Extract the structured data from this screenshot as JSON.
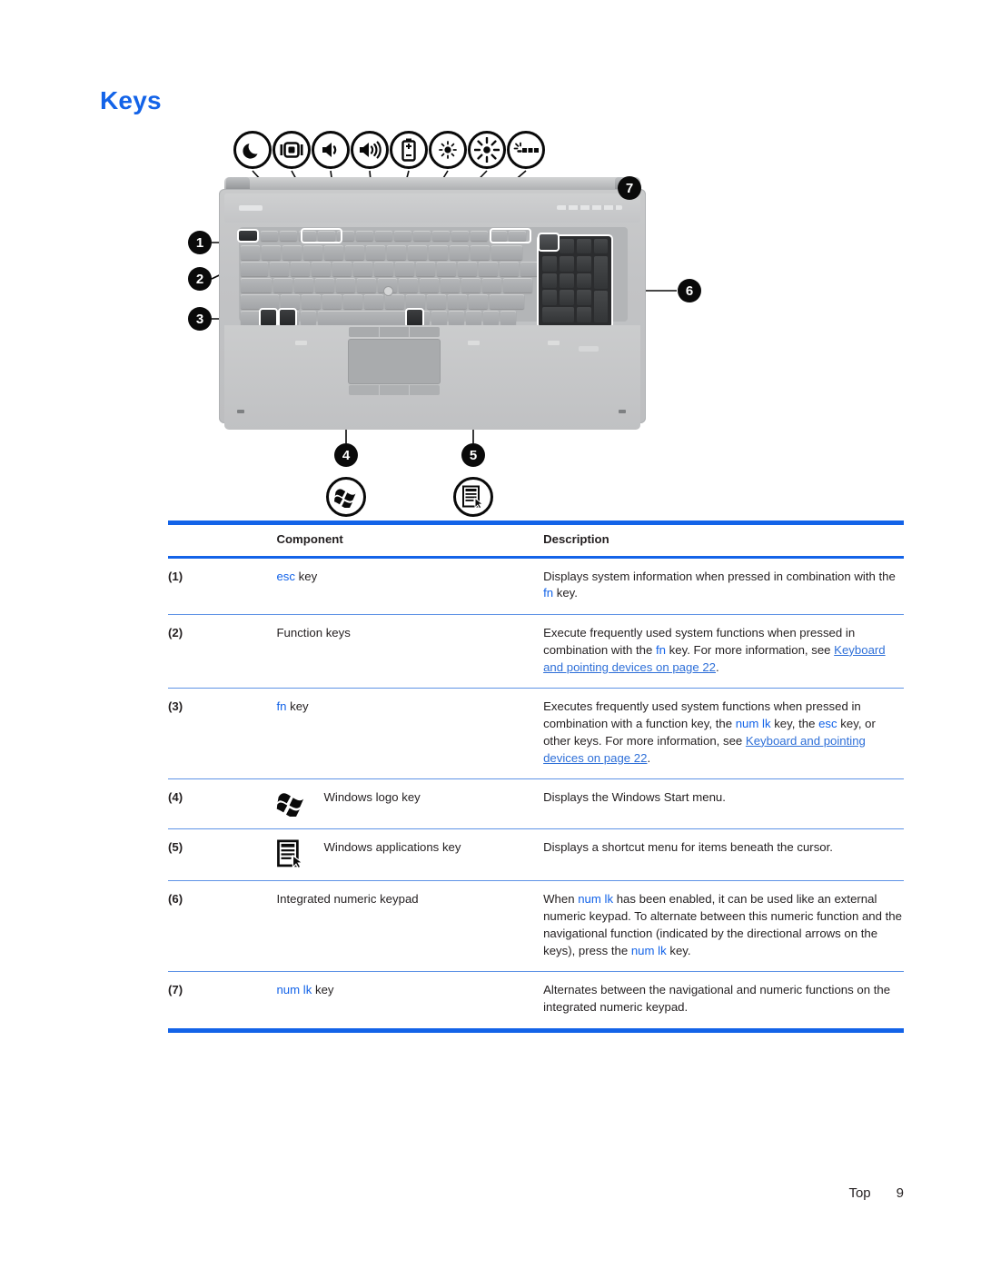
{
  "page": {
    "title": "Keys",
    "footer_label": "Top",
    "page_number": "9"
  },
  "colors": {
    "heading_blue": "#1363e8",
    "link_blue": "#2e6fd8",
    "keyword_blue": "#1363e8",
    "rule_blue": "#1363e8",
    "row_rule_blue": "#5f93e6"
  },
  "figure": {
    "alt": "HP laptop top view with numbered callouts",
    "fn_icons": [
      {
        "name": "sleep-icon",
        "label": "Sleep"
      },
      {
        "name": "display-switch-icon",
        "label": "Switch screen image"
      },
      {
        "name": "volume-mute-icon",
        "label": "Mute"
      },
      {
        "name": "volume-up-icon",
        "label": "Volume up"
      },
      {
        "name": "battery-icon",
        "label": "Battery information"
      },
      {
        "name": "brightness-down-icon",
        "label": "Decrease screen brightness"
      },
      {
        "name": "brightness-up-icon",
        "label": "Increase screen brightness"
      },
      {
        "name": "keyboard-backlight-icon",
        "label": "Keyboard backlight"
      }
    ],
    "callouts": [
      {
        "n": "1",
        "target": "esc key"
      },
      {
        "n": "2",
        "target": "Function keys"
      },
      {
        "n": "3",
        "target": "fn key"
      },
      {
        "n": "4",
        "target": "Windows logo key"
      },
      {
        "n": "5",
        "target": "Windows applications key"
      },
      {
        "n": "6",
        "target": "Integrated numeric keypad"
      },
      {
        "n": "7",
        "target": "num lk key"
      }
    ],
    "bottom_icons": [
      {
        "n": "4",
        "name": "windows-logo-icon"
      },
      {
        "n": "5",
        "name": "windows-applications-icon"
      }
    ]
  },
  "table": {
    "headers": {
      "component": "Component",
      "description": "Description"
    },
    "rows": [
      {
        "num": "(1)",
        "component_kw": "esc",
        "component_rest": " key",
        "icon": null,
        "desc_html": "Displays system information when pressed in combination with the <span class=\"kw\">fn</span> key."
      },
      {
        "num": "(2)",
        "component_kw": "",
        "component_rest": "Function keys",
        "icon": null,
        "desc_html": "Execute frequently used system functions when pressed in combination with the <span class=\"kw\">fn</span> key. For more information, see <span class=\"lnk\">Keyboard and pointing devices on page 22</span>."
      },
      {
        "num": "(3)",
        "component_kw": "fn",
        "component_rest": " key",
        "icon": null,
        "desc_html": "Executes frequently used system functions when pressed in combination with a function key, the <span class=\"kw\">num lk</span> key, the <span class=\"kw\">esc</span> key, or other keys. For more information, see <span class=\"lnk\">Keyboard and pointing devices on page 22</span>."
      },
      {
        "num": "(4)",
        "component_kw": "",
        "component_rest": "Windows logo key",
        "icon": "windows-logo-icon",
        "desc_html": "Displays the Windows Start menu."
      },
      {
        "num": "(5)",
        "component_kw": "",
        "component_rest": "Windows applications key",
        "icon": "windows-applications-icon",
        "desc_html": "Displays a shortcut menu for items beneath the cursor."
      },
      {
        "num": "(6)",
        "component_kw": "",
        "component_rest": "Integrated numeric keypad",
        "icon": null,
        "desc_html": "When <span class=\"kw\">num lk</span> has been enabled, it can be used like an external numeric keypad. To alternate between this numeric function and the navigational function (indicated by the directional arrows on the keys), press the <span class=\"kw\">num lk</span> key."
      },
      {
        "num": "(7)",
        "component_kw": "num lk",
        "component_rest": " key",
        "icon": null,
        "desc_html": "Alternates between the navigational and numeric functions on the integrated numeric keypad."
      }
    ]
  }
}
